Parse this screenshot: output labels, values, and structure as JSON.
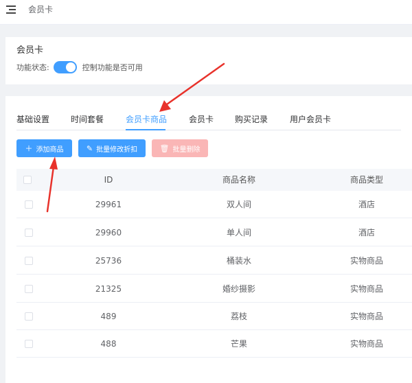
{
  "header": {
    "breadcrumb": "会员卡",
    "menu_icon": "hamburger-menu-icon"
  },
  "status_card": {
    "title": "会员卡",
    "status_label": "功能状态:",
    "switch_on": true,
    "hint": "控制功能是否可用"
  },
  "tabs": [
    {
      "label": "基础设置"
    },
    {
      "label": "时间套餐"
    },
    {
      "label": "会员卡商品",
      "active": true
    },
    {
      "label": "会员卡"
    },
    {
      "label": "购买记录"
    },
    {
      "label": "用户会员卡"
    }
  ],
  "toolbar": {
    "add_icon": "＋",
    "add_label": "添加商品",
    "edit_icon": "✎",
    "edit_label": "批量修改折扣",
    "delete_icon": "🗑",
    "delete_label": "批量删除"
  },
  "table": {
    "columns": [
      "ID",
      "商品名称",
      "商品类型"
    ],
    "rows": [
      {
        "id": "29961",
        "name": "双人间",
        "type": "酒店"
      },
      {
        "id": "29960",
        "name": "单人间",
        "type": "酒店"
      },
      {
        "id": "25736",
        "name": "桶装水",
        "type": "实物商品"
      },
      {
        "id": "21325",
        "name": "婚纱摄影",
        "type": "实物商品"
      },
      {
        "id": "489",
        "name": "荔枝",
        "type": "实物商品"
      },
      {
        "id": "488",
        "name": "芒果",
        "type": "实物商品"
      }
    ]
  },
  "colors": {
    "primary": "#409eff",
    "danger_disabled": "#fab6b6",
    "annotation": "#e8322b"
  }
}
